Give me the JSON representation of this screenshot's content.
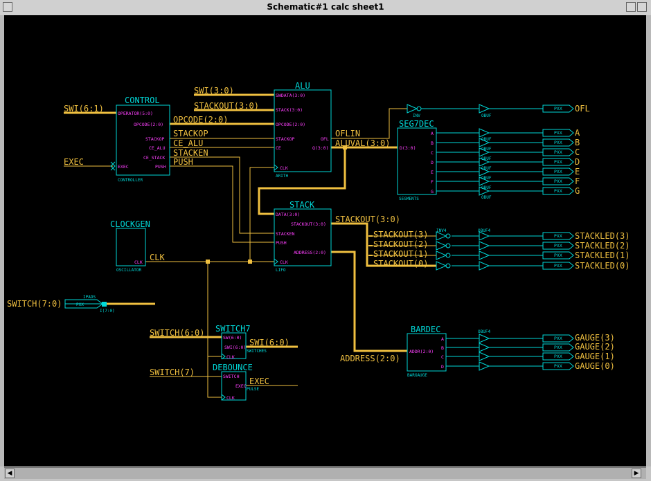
{
  "window": {
    "title": "Schematic#1 calc sheet1"
  },
  "colors": {
    "background": "#000000",
    "component": "#00d8d8",
    "wire": "#f0c040",
    "pin": "#ff40ff"
  },
  "components": {
    "control": {
      "name": "CONTROL",
      "type": "CONTROLLER",
      "pins": {
        "operator": "OPERATOR(5:0)",
        "opcode": "OPCODE(2:0)",
        "stackop": "STACKOP",
        "ce_alu": "CE_ALU",
        "ce_stack": "CE_STACK",
        "exec": "EXEC",
        "push": "PUSH"
      }
    },
    "alu": {
      "name": "ALU",
      "type": "ARITH",
      "pins": {
        "swdata": "SWDATA(3:0)",
        "stack": "STACK(3:0)",
        "opcode": "OPCODE(2:0)",
        "stackop": "STACKOP",
        "ce": "CE",
        "ofl": "OFL",
        "q": "Q(3:0)",
        "clk": "CLK"
      }
    },
    "seg7dec": {
      "name": "SEG7DEC",
      "type": "SEGMENTS",
      "pins": {
        "d": "D(3:0)",
        "a": "A",
        "b": "B",
        "c": "C",
        "dd": "D",
        "e": "E",
        "f": "F",
        "g": "G"
      }
    },
    "stack": {
      "name": "STACK",
      "type": "LIFO",
      "pins": {
        "data": "DATA(3:0)",
        "stackout": "STACKOUT(3:0)",
        "stacken": "STACKEN",
        "push": "PUSH",
        "address": "ADDRESS(2:0)",
        "clk": "CLK"
      }
    },
    "clockgen": {
      "name": "CLOCKGEN",
      "type": "OSCILLATOR",
      "pins": {
        "clk": "CLK"
      }
    },
    "switch7": {
      "name": "SWITCH7",
      "type": "SWITCHES",
      "pins": {
        "sw": "SW(6:0)",
        "swi": "SWI(6:0)",
        "clk": "CLK"
      }
    },
    "debounce": {
      "name": "DEBOUNCE",
      "type": "PULSE",
      "pins": {
        "switch": "SWITCH",
        "exec": "EXEC",
        "clk": "CLK"
      }
    },
    "bardec": {
      "name": "BARDEC",
      "type": "BARGAUGE",
      "pins": {
        "addr": "ADDR(2:0)",
        "a": "A",
        "b": "B",
        "c": "C",
        "d": "D"
      }
    },
    "ipads": {
      "name": "IPADS",
      "pad": "PXX",
      "pin": "I(7:0)"
    }
  },
  "gates": {
    "inv": "INV",
    "inv4": "INV4",
    "obuf": "OBUF",
    "obuf4": "OBUF4",
    "pad": "PXX"
  },
  "nets": {
    "swi_6_1": "SWI(6:1)",
    "exec": "EXEC",
    "swi_3_0": "SWI(3:0)",
    "stackout_3_0": "STACKOUT(3:0)",
    "opcode": "OPCODE(2:0)",
    "stackop": "STACKOP",
    "ce_alu": "CE_ALU",
    "stacken": "STACKEN",
    "push": "PUSH",
    "oflin": "OFLIN",
    "aluval": "ALUVAL(3:0)",
    "clk": "CLK",
    "stackout_bus": "STACKOUT(3:0)",
    "stackout3": "STACKOUT(3)",
    "stackout2": "STACKOUT(2)",
    "stackout1": "STACKOUT(1)",
    "stackout0": "STACKOUT(0)",
    "switch_7_0": "SWITCH(7:0)",
    "switch_6_0": "SWITCH(6:0)",
    "swi_6_0": "SWI(6:0)",
    "switch7": "SWITCH(7)",
    "exec2": "EXEC",
    "address": "ADDRESS(2:0)"
  },
  "outputs": {
    "ofl": "OFL",
    "a": "A",
    "b": "B",
    "c": "C",
    "d": "D",
    "e": "E",
    "f": "F",
    "g": "G",
    "stackled3": "STACKLED(3)",
    "stackled2": "STACKLED(2)",
    "stackled1": "STACKLED(1)",
    "stackled0": "STACKLED(0)",
    "gauge3": "GAUGE(3)",
    "gauge2": "GAUGE(2)",
    "gauge1": "GAUGE(1)",
    "gauge0": "GAUGE(0)"
  }
}
